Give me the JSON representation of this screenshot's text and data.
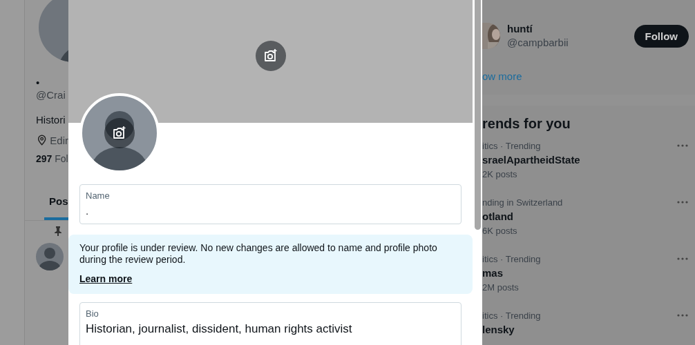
{
  "background_profile": {
    "name": "•",
    "handle": "@Crai",
    "bio": "Histori",
    "location": "Edir",
    "following_count": "297",
    "following_label": "Fol",
    "tabs": [
      {
        "label": "Pos",
        "selected": true
      }
    ]
  },
  "edit_profile_dialog": {
    "name_field": {
      "label": "Name",
      "value": "."
    },
    "review_notice": {
      "text": "Your profile is under review. No new changes are allowed to name and profile photo during the review period.",
      "link": "Learn more"
    },
    "bio_field": {
      "label": "Bio",
      "value": "Historian, journalist, dissident, human rights activist"
    }
  },
  "sidebar": {
    "who_to_follow": [
      {
        "name": "huntí",
        "handle": "@campbarbii",
        "button": "Follow"
      }
    ],
    "show_more": "ow more",
    "trends_title": "rends for you",
    "trends": [
      {
        "context": "itics · Trending",
        "title": "sraelApartheidState",
        "posts": "2K posts"
      },
      {
        "context": "nding in Switzerland",
        "title": "otland",
        "posts": "6K posts"
      },
      {
        "context": "itics · Trending",
        "title": "mas",
        "posts": "2M posts"
      },
      {
        "context": "itics · Trending",
        "title": "lensky"
      }
    ]
  }
}
